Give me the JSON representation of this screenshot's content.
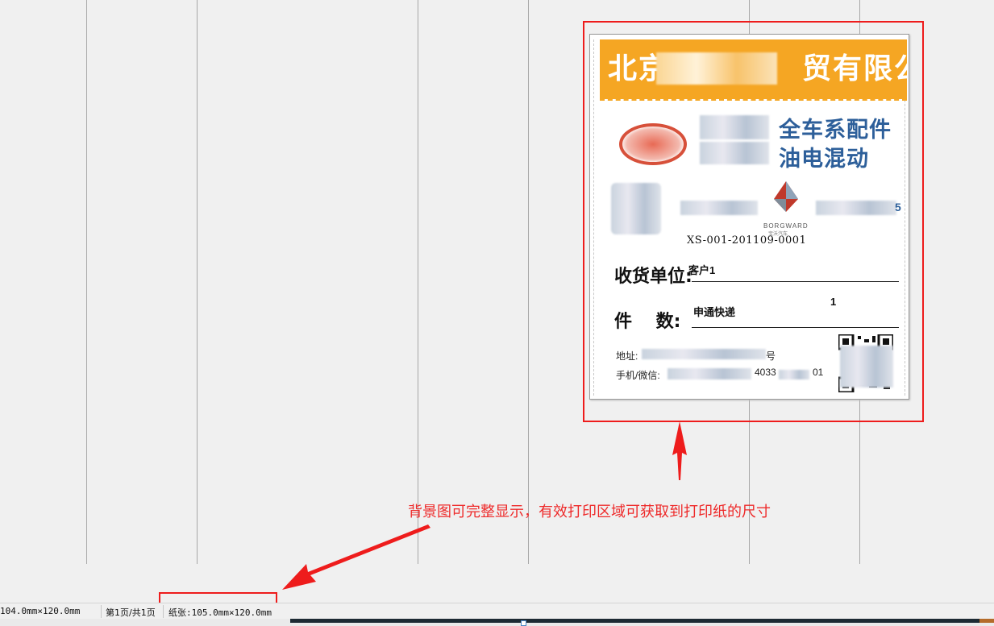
{
  "label": {
    "company_left": "北京",
    "company_right": "贸有限公司",
    "tagline_1": "全车系配件",
    "tagline_2": "油电混动",
    "brand_suffix": "5",
    "borg_text": "BORGWARD",
    "borg_sub": "宝沃汽车",
    "order_code": "XS-001-201109-0001",
    "receiver_label": "收货单位:",
    "receiver_value": "客户1",
    "count_label": "件　 数:",
    "count_value": "申通快递",
    "count_number": "1",
    "address_label": "地址:",
    "address_suffix": "号",
    "phone_label": "手机/微信:",
    "phone_partial_1": "4033",
    "phone_partial_2": "01"
  },
  "annotation": {
    "text": "背景图可完整显示，有效打印区域可获取到打印纸的尺寸"
  },
  "statusbar": {
    "size": "104.0mm×120.0mm",
    "page": "第1页/共1页",
    "paper": "纸张:105.0mm×120.0mm"
  },
  "colors": {
    "highlight": "#ee1c1c",
    "banner": "#f5a623",
    "brand_blue": "#2d5f9a"
  }
}
